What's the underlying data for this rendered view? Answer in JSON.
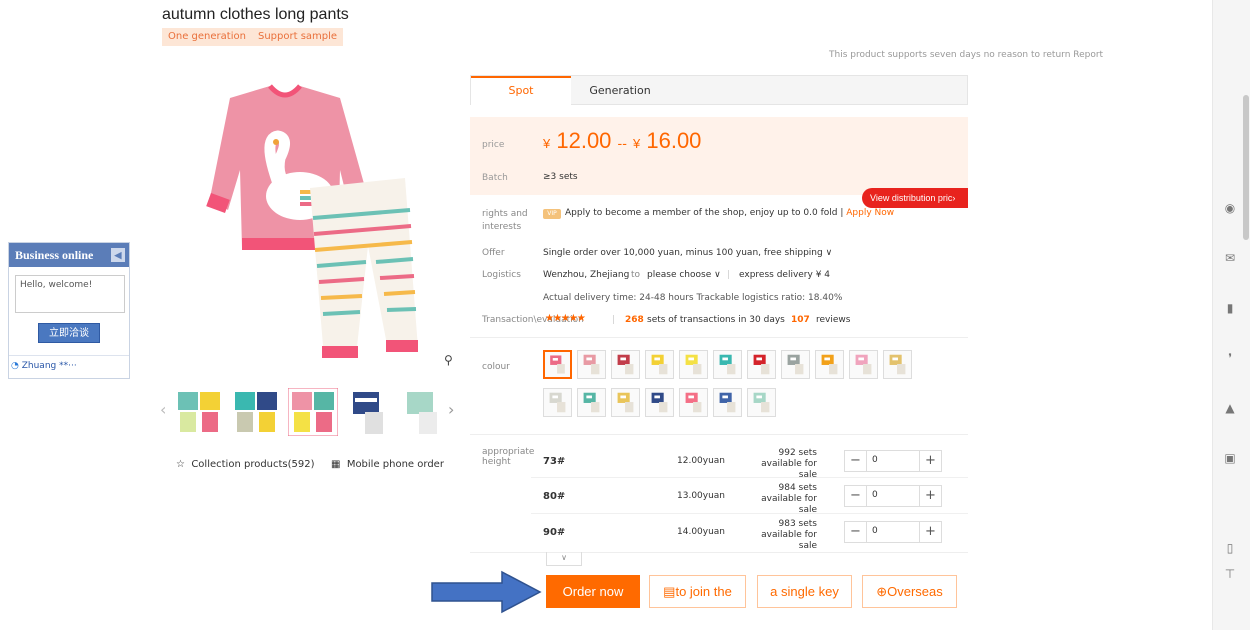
{
  "product": {
    "title": "autumn clothes long pants",
    "tags": [
      "One generation",
      "Support sample"
    ],
    "return_note": "This product supports seven days no reason to return  Report"
  },
  "business_widget": {
    "title": "Business online",
    "collapse_icon": "arrow-left-icon",
    "input_placeholder": "Hello, welcome!",
    "button_label": "立即洽谈",
    "user_name": "Zhuang **···"
  },
  "gallery": {
    "zoom_icon": "search-icon",
    "collection_label": "Collection products(592)",
    "mobile_label": "Mobile phone order"
  },
  "tabs": [
    {
      "label": "Spot",
      "active": true
    },
    {
      "label": "Generation",
      "active": false
    }
  ],
  "pricing": {
    "price_label": "price",
    "price_low": "12.00",
    "price_sep": "--",
    "price_high": "16.00",
    "currency": "¥",
    "batch_label": "Batch",
    "batch_value": "≥3 sets",
    "distribution_button": "View distribution pric›"
  },
  "rights": {
    "label": "rights and interests",
    "badge": "VIP",
    "text": "Apply to become a member of the shop, enjoy up to 0.0 fold | ",
    "link": "Apply Now"
  },
  "offer": {
    "label": "Offer",
    "text": "Single order over 10,000 yuan, minus 100 yuan, free shipping ∨"
  },
  "logistics": {
    "label": "Logistics",
    "from": "Wenzhou, Zhejiang",
    "to_label": "to",
    "choose": "please choose  ∨",
    "separator": "|",
    "express": "express delivery ¥ 4",
    "delivery_note": "Actual delivery time:  24-48 hours   Trackable logistics ratio:  18.40%"
  },
  "transactions": {
    "label": "Transaction\\evaluation",
    "stars": "★★★★★",
    "separator": "|",
    "count": "268",
    "count_text": "sets of transactions in 30 days",
    "reviews": "107",
    "reviews_text": "reviews"
  },
  "colour": {
    "label": "colour",
    "swatches": [
      "#ec6b86",
      "#e89aa4",
      "#c23d4a",
      "#f3d135",
      "#f4e145",
      "#3ab8b0",
      "#d4232a",
      "#9aa3a0",
      "#f2a11a",
      "#f0a4bd",
      "#e3c26d",
      "#d8d8d0",
      "#56b6a5",
      "#e9c55a",
      "#304a88",
      "#f46f86",
      "#4064a8",
      "#a7d7c7"
    ]
  },
  "sizes": {
    "label": "appropriate height",
    "rows": [
      {
        "name": "73#",
        "price": "12.00yuan",
        "stock_line1": "992 sets",
        "stock_line2": "available for sale",
        "qty": "0"
      },
      {
        "name": "80#",
        "price": "13.00yuan",
        "stock_line1": "984 sets",
        "stock_line2": "available for sale",
        "qty": "0"
      },
      {
        "name": "90#",
        "price": "14.00yuan",
        "stock_line1": "983 sets",
        "stock_line2": "available for sale",
        "qty": "0"
      }
    ],
    "expand_icon": "chevron-down-icon"
  },
  "actions": {
    "order": "Order now",
    "join": "to join the",
    "single": "a single key",
    "overseas": "Overseas"
  },
  "colors": {
    "accent": "#ff6a00",
    "price_bg": "#fff2ea",
    "widget_header": "#5b7db8",
    "annotation_arrow": "#4472c4"
  }
}
